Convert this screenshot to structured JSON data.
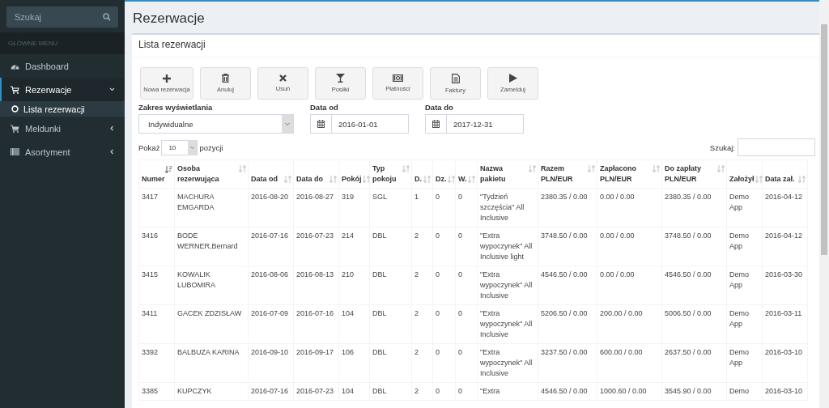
{
  "sidebar": {
    "search": {
      "placeholder": "Szukaj"
    },
    "menu_header": "GŁÓWNE MENU",
    "items": [
      {
        "label": "Dashboard",
        "selected": false
      },
      {
        "label": "Rezerwacje",
        "selected": true,
        "expanded": true,
        "children": [
          {
            "label": "Lista rezerwacji",
            "selected": true
          }
        ]
      },
      {
        "label": "Meldunki",
        "selected": false,
        "expanded": false
      },
      {
        "label": "Asortyment",
        "selected": false,
        "expanded": false
      }
    ]
  },
  "page_title": "Rezerwacje",
  "box_title": "Lista rezerwacji",
  "toolbar": [
    {
      "label": "Nowa rezerwacja"
    },
    {
      "label": "Anuluj"
    },
    {
      "label": "Usuń"
    },
    {
      "label": "Posiłki"
    },
    {
      "label": "Płatności"
    },
    {
      "label": "Faktury"
    },
    {
      "label": "Zamelduj"
    }
  ],
  "filters": {
    "range": {
      "label": "Zakres wyświetlania",
      "value": "Indywidualne"
    },
    "date_from": {
      "label": "Data od",
      "value": "2016-01-01"
    },
    "date_to": {
      "label": "Data do",
      "value": "2017-12-31"
    }
  },
  "length": {
    "before": "Pokaż",
    "value": "10",
    "after": "pozycji"
  },
  "table_search": {
    "label": "Szukaj:"
  },
  "table": {
    "columns": [
      {
        "label": "Numer",
        "sorted": true
      },
      {
        "label": "Osoba rezerwująca",
        "sorted": false
      },
      {
        "label": "Data od",
        "sorted": false
      },
      {
        "label": "Data do",
        "sorted": false
      },
      {
        "label": "Pokój",
        "sorted": false
      },
      {
        "label": "Typ pokoju",
        "sorted": false
      },
      {
        "label": "D.",
        "sorted": false
      },
      {
        "label": "Dz.",
        "sorted": false
      },
      {
        "label": "W.",
        "sorted": false
      },
      {
        "label": "Nazwa pakietu",
        "sorted": false
      },
      {
        "label": "Razem PLN/EUR",
        "sorted": false
      },
      {
        "label": "Zapłacono PLN/EUR",
        "sorted": false
      },
      {
        "label": "Do zapłaty PLN/EUR",
        "sorted": false
      },
      {
        "label": "Założył",
        "sorted": false
      },
      {
        "label": "Data zał.",
        "sorted": false
      }
    ],
    "rows": [
      [
        "3417",
        "MACHURA EMGARDA",
        "2016-08-20",
        "2016-08-27",
        "319",
        "SGL",
        "1",
        "0",
        "0",
        "\"Tydzień szczęścia\" All Inclusive",
        "2380.35 / 0.00",
        "0.00 / 0.00",
        "2380.35 / 0.00",
        "Demo App",
        "2016-04-12"
      ],
      [
        "3416",
        "BODE WERNER,Bernard",
        "2016-07-16",
        "2016-07-23",
        "214",
        "DBL",
        "2",
        "0",
        "0",
        "\"Extra wypoczynek\" All Inclusive light",
        "3748.50 / 0.00",
        "0.00 / 0.00",
        "3748.50 / 0.00",
        "Demo App",
        "2016-04-12"
      ],
      [
        "3415",
        "KOWALIK LUBOMIRA",
        "2016-08-06",
        "2016-08-13",
        "210",
        "DBL",
        "2",
        "0",
        "0",
        "\"Extra wypoczynek\" All Inclusive",
        "4546.50 / 0.00",
        "0.00 / 0.00",
        "4546.50 / 0.00",
        "Demo App",
        "2016-03-30"
      ],
      [
        "3411",
        "GACEK ZDZISŁAW",
        "2016-07-09",
        "2016-07-16",
        "104",
        "DBL",
        "2",
        "0",
        "0",
        "\"Extra wypoczynek\" All Inclusive",
        "5206.50 / 0.00",
        "200.00 / 0.00",
        "5006.50 / 0.00",
        "Demo App",
        "2016-03-11"
      ],
      [
        "3392",
        "BALBUZA KARINA",
        "2016-09-10",
        "2016-09-17",
        "106",
        "DBL",
        "2",
        "0",
        "0",
        "\"Extra wypoczynek\" All Inclusive",
        "3237.50 / 0.00",
        "600.00 / 0.00",
        "2637.50 / 0.00",
        "Demo App",
        "2016-03-10"
      ],
      [
        "3385",
        "KUPCZYK",
        "2016-07-16",
        "2016-07-23",
        "104",
        "DBL",
        "2",
        "0",
        "0",
        "\"Extra",
        "4546.50 / 0.00",
        "1000.60 / 0.00",
        "3545.90 / 0.00",
        "Demo",
        "2016-03-10"
      ]
    ]
  }
}
